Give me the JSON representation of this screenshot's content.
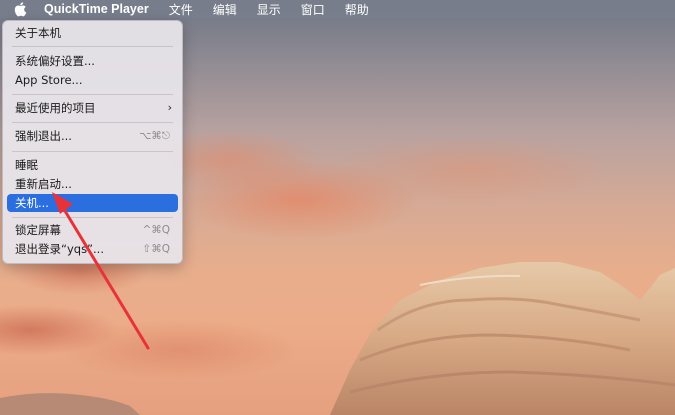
{
  "menubar": {
    "app_name": "QuickTime Player",
    "items": [
      "文件",
      "编辑",
      "显示",
      "窗口",
      "帮助"
    ]
  },
  "apple_menu": {
    "about": "关于本机",
    "system_prefs": "系统偏好设置...",
    "app_store": "App Store...",
    "recent_items": "最近使用的项目",
    "force_quit": "强制退出...",
    "force_quit_shortcut": "⌥⌘⎋",
    "sleep": "睡眠",
    "restart": "重新启动...",
    "shutdown": "关机...",
    "lock_screen": "锁定屏幕",
    "lock_screen_shortcut": "^⌘Q",
    "logout": "退出登录“yqs”...",
    "logout_shortcut": "⇧⌘Q"
  },
  "colors": {
    "highlight": "#2b6ee0",
    "annotation_arrow": "#e8323a"
  }
}
